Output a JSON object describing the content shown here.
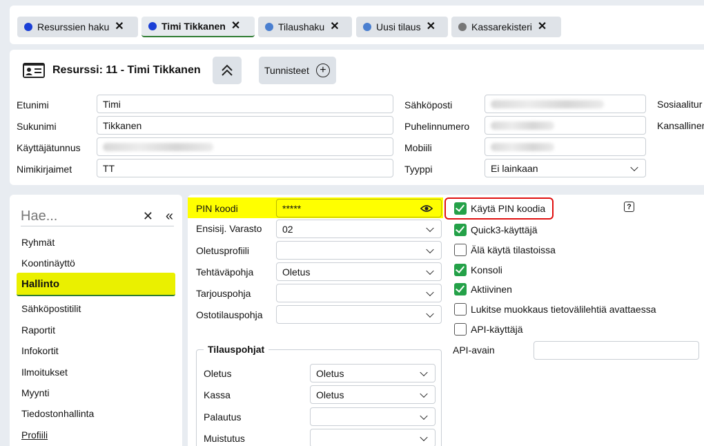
{
  "tabs": [
    {
      "label": "Resurssien haku",
      "dot": "#1a3fd6"
    },
    {
      "label": "Timi Tikkanen",
      "dot": "#1a3fd6"
    },
    {
      "label": "Tilaushaku",
      "dot": "#4a7fd0"
    },
    {
      "label": "Uusi tilaus",
      "dot": "#4a7fd0"
    },
    {
      "label": "Kassarekisteri",
      "dot": "#777777"
    }
  ],
  "header": {
    "title": "Resurssi: 11 - Timi Tikkanen",
    "tags_label": "Tunnisteet"
  },
  "person": {
    "etunimi_label": "Etunimi",
    "etunimi": "Timi",
    "sukunimi_label": "Sukunimi",
    "sukunimi": "Tikkanen",
    "kayttajatunnus_label": "Käyttäjätunnus",
    "nimikirjaimet_label": "Nimikirjaimet",
    "nimikirjaimet": "TT",
    "sahkoposti_label": "Sähköposti",
    "puhelin_label": "Puhelinnumero",
    "mobiili_label": "Mobiili",
    "tyyppi_label": "Tyyppi",
    "tyyppi": "Ei lainkaan",
    "sosiaali_label": "Sosiaalitur",
    "kansallinen_label": "Kansalliner"
  },
  "nav": {
    "search_placeholder": "Hae...",
    "items": [
      "Ryhmät",
      "Koontinäyttö",
      "Hallinto",
      "Sähköpostitilit",
      "Raportit",
      "Infokortit",
      "Ilmoitukset",
      "Myynti",
      "Tiedostonhallinta",
      "Profiili"
    ]
  },
  "form": {
    "pin_label": "PIN koodi",
    "pin_value": "*****",
    "varasto_label": "Ensisij. Varasto",
    "varasto": "02",
    "oletusprofiili_label": "Oletusprofiili",
    "tehtavapohja_label": "Tehtäväpohja",
    "tehtavapohja": "Oletus",
    "tarjouspohja_label": "Tarjouspohja",
    "ostotilauspohja_label": "Ostotilauspohja",
    "tilauspohjat_legend": "Tilauspohjat",
    "oletus_label": "Oletus",
    "oletus": "Oletus",
    "kassa_label": "Kassa",
    "kassa": "Oletus",
    "palautus_label": "Palautus",
    "muistutus_label": "Muistutus"
  },
  "checks": [
    {
      "label": "Käytä PIN koodia",
      "checked": true
    },
    {
      "label": "Quick3-käyttäjä",
      "checked": true
    },
    {
      "label": "Älä käytä tilastoissa",
      "checked": false
    },
    {
      "label": "Konsoli",
      "checked": true
    },
    {
      "label": "Aktiivinen",
      "checked": true
    },
    {
      "label": "Lukitse muokkaus tietovälilehtiä avattaessa",
      "checked": false
    },
    {
      "label": "API-käyttäjä",
      "checked": false
    }
  ],
  "api_key_label": "API-avain",
  "help_glyph": "?"
}
